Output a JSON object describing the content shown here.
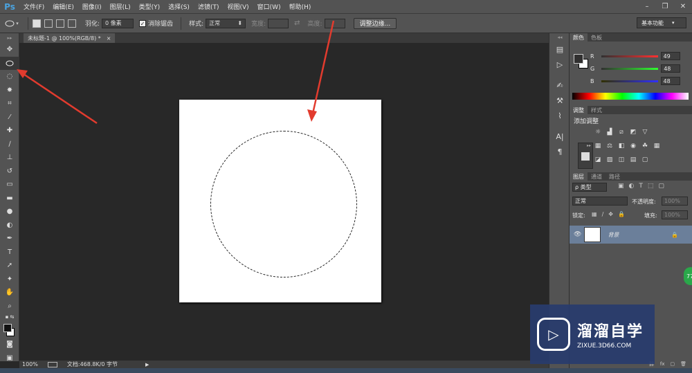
{
  "app": {
    "logo": "Ps"
  },
  "menu": [
    "文件(F)",
    "编辑(E)",
    "图像(I)",
    "图层(L)",
    "类型(Y)",
    "选择(S)",
    "滤镜(T)",
    "视图(V)",
    "窗口(W)",
    "帮助(H)"
  ],
  "window_controls": [
    "minimize-icon",
    "restore-icon",
    "close-icon"
  ],
  "options": {
    "feather_label": "羽化:",
    "feather_value": "0 像素",
    "antialias_label": "消除锯齿",
    "style_label": "样式:",
    "style_value": "正常",
    "width_label": "宽度:",
    "height_label": "高度:",
    "refine_button": "调整边缘...",
    "workspace": "基本功能"
  },
  "document": {
    "tab_title": "未标题-1 @ 100%(RGB/8) *",
    "tab_close": "×"
  },
  "status": {
    "zoom": "100%",
    "doc_info": "文档:468.8K/0 字节"
  },
  "color_panel": {
    "tabs": [
      "颜色",
      "色板"
    ],
    "channels": [
      {
        "label": "R",
        "value": "49"
      },
      {
        "label": "G",
        "value": "48"
      },
      {
        "label": "B",
        "value": "48"
      }
    ]
  },
  "adjust_panel": {
    "tabs": [
      "调整",
      "样式"
    ],
    "title": "添加调整"
  },
  "layers_panel": {
    "tabs": [
      "图层",
      "通道",
      "路径"
    ],
    "filter": "ρ 类型",
    "blend_mode": "正常",
    "opacity_label": "不透明度:",
    "opacity_value": "100%",
    "lock_label": "锁定:",
    "fill_label": "填充:",
    "fill_value": "100%",
    "layer_name": "背景"
  },
  "watermark": {
    "title": "溜溜自学",
    "url": "ZIXUE.3D66.COM"
  },
  "badge": {
    "text": "77"
  }
}
